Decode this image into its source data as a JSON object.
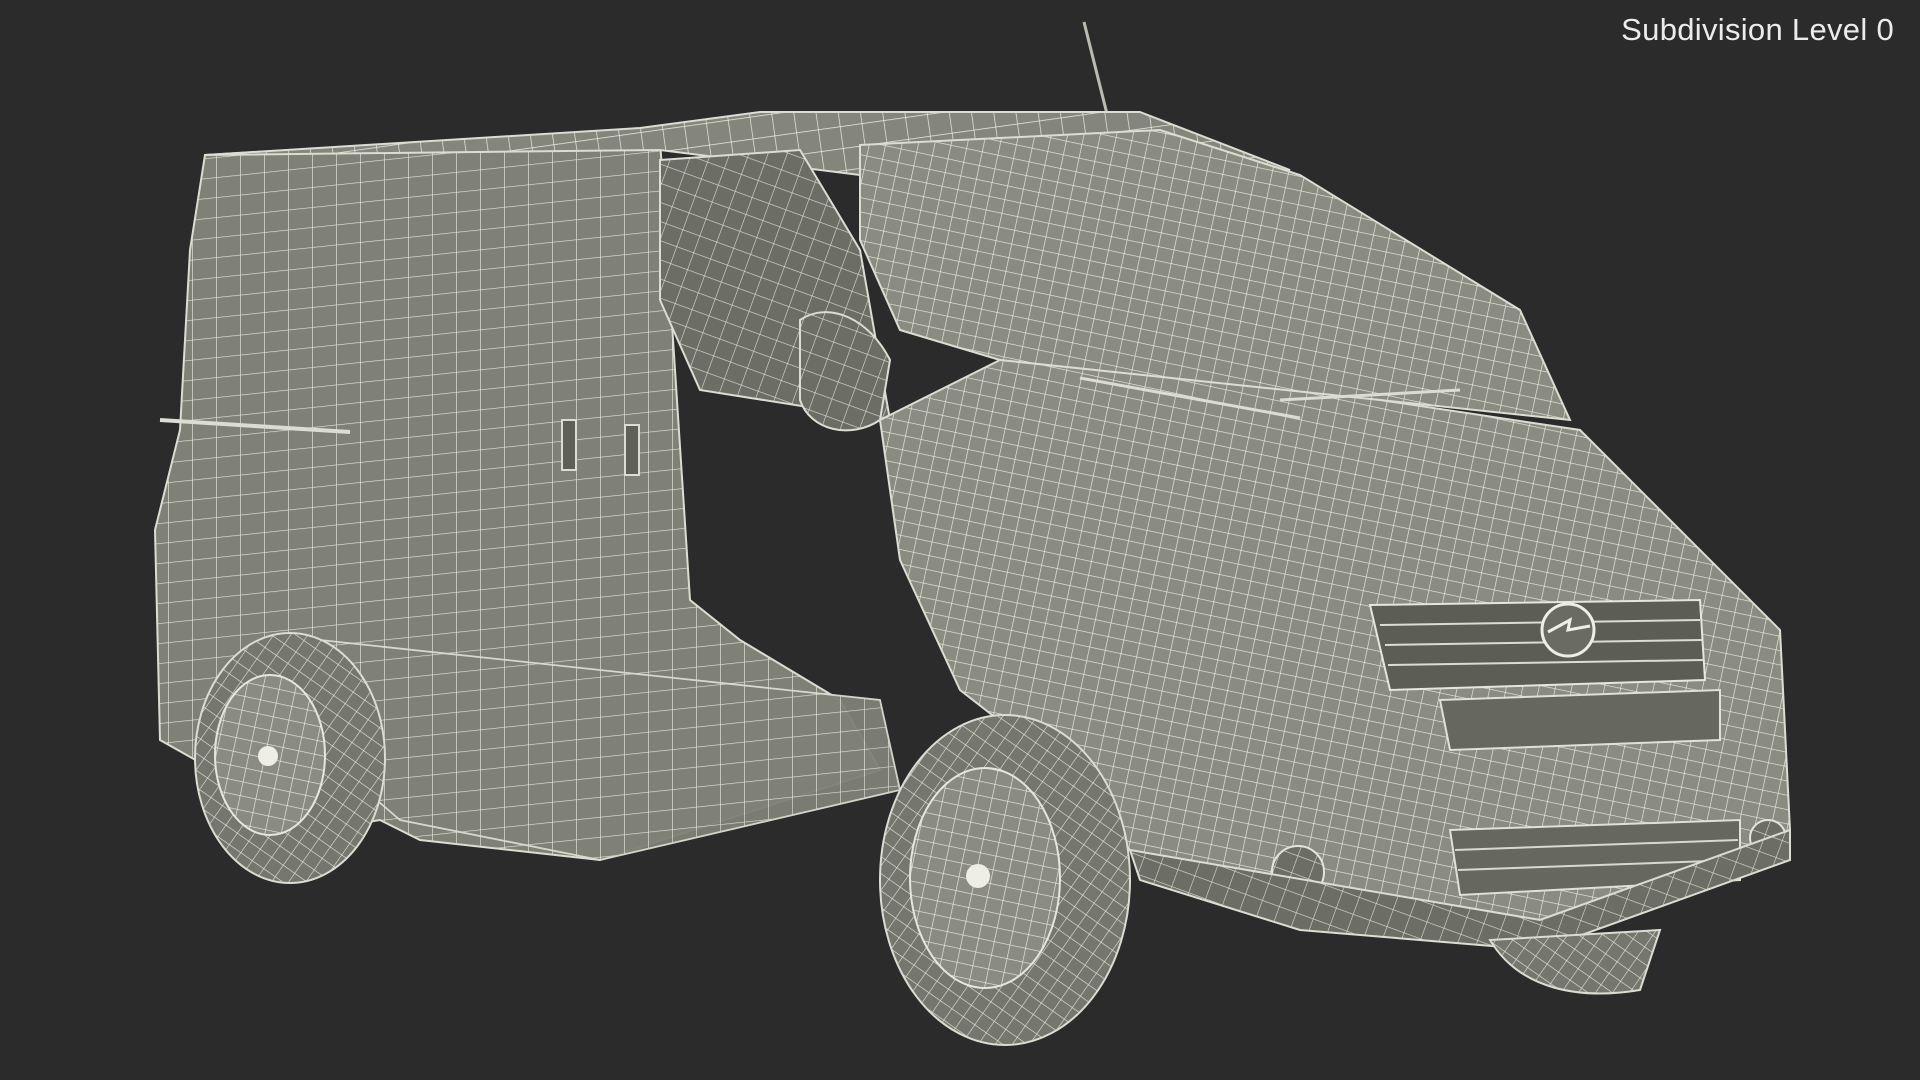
{
  "viewport": {
    "subdivision_label": "Subdivision Level 0",
    "background_color": "#2b2b2b",
    "model_fill_color": "#8a8b80",
    "wire_color": "#e9e9e0"
  },
  "model": {
    "subject": "van-wireframe-model",
    "logo": "opel-logo-icon"
  }
}
